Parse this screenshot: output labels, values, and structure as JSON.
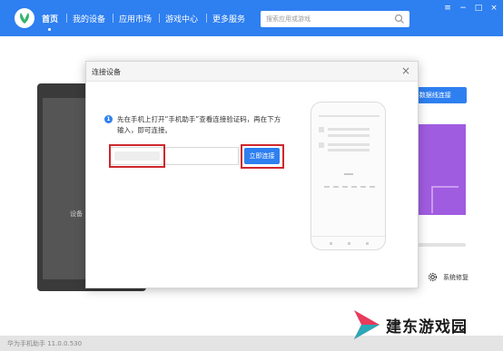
{
  "nav": {
    "items": [
      {
        "label": "首页"
      },
      {
        "label": "我的设备"
      },
      {
        "label": "应用市场"
      },
      {
        "label": "游戏中心"
      },
      {
        "label": "更多服务"
      }
    ],
    "active": "首页"
  },
  "search": {
    "placeholder": "搜索应用或游戏"
  },
  "window_controls": {
    "menu": "≡",
    "minimize": "−",
    "maximize": "□",
    "close": "×"
  },
  "background": {
    "usb_button": "B数据线连接",
    "phone_label": "设备",
    "repair_label": "系统修复"
  },
  "dialog": {
    "title": "连接设备",
    "info_num": "1",
    "instruction": "先在手机上打开“手机助手”查看连接验证码，再在下方输入，即可连接。",
    "code_value": "",
    "connect_button": "立即连接"
  },
  "status": {
    "version": "华为手机助手 11.0.0.530"
  },
  "watermark": {
    "text": "建东游戏园"
  },
  "colors": {
    "primary": "#2e7ff0",
    "highlight": "#d0272c",
    "promo": "#a05ce0"
  }
}
